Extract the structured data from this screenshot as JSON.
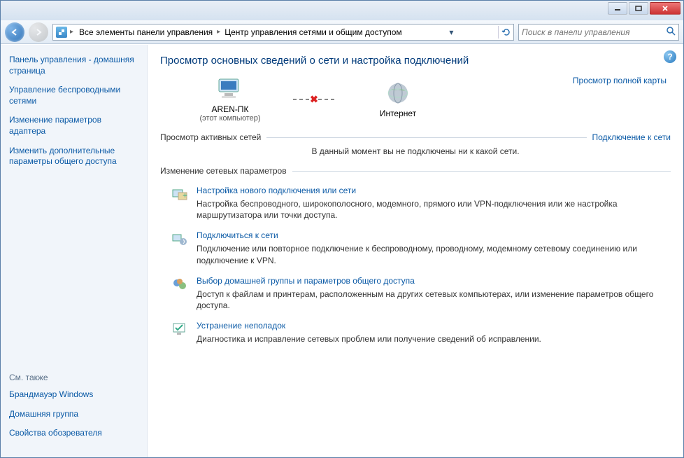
{
  "titlebar": {},
  "navbar": {
    "breadcrumb": {
      "a": "Все элементы панели управления",
      "b": "Центр управления сетями и общим доступом"
    },
    "search_placeholder": "Поиск в панели управления"
  },
  "sidebar": {
    "home": "Панель управления - домашняя страница",
    "links": {
      "wireless": "Управление беспроводными сетями",
      "adapter": "Изменение параметров адаптера",
      "sharing": "Изменить дополнительные параметры общего доступа"
    },
    "see_also_label": "См. также",
    "see_also": {
      "firewall": "Брандмауэр Windows",
      "homegroup": "Домашняя группа",
      "internet_options": "Свойства обозревателя"
    }
  },
  "content": {
    "heading": "Просмотр основных сведений о сети и настройка подключений",
    "map_link": "Просмотр полной карты",
    "nodes": {
      "pc_name": "AREN-ПК",
      "pc_sub": "(этот компьютер)",
      "internet": "Интернет"
    },
    "active_networks_label": "Просмотр активных сетей",
    "connect_link": "Подключение к сети",
    "no_networks_msg": "В данный момент вы не подключены ни к какой сети.",
    "change_settings_label": "Изменение сетевых параметров",
    "tasks": {
      "t1": {
        "title": "Настройка нового подключения или сети",
        "desc": "Настройка беспроводного, широкополосного, модемного, прямого или VPN-подключения или же настройка маршрутизатора или точки доступа."
      },
      "t2": {
        "title": "Подключиться к сети",
        "desc": "Подключение или повторное подключение к беспроводному, проводному, модемному сетевому соединению или подключение к VPN."
      },
      "t3": {
        "title": "Выбор домашней группы и параметров общего доступа",
        "desc": "Доступ к файлам и принтерам, расположенным на других сетевых компьютерах, или изменение параметров общего доступа."
      },
      "t4": {
        "title": "Устранение неполадок",
        "desc": "Диагностика и исправление сетевых проблем или получение сведений об исправлении."
      }
    }
  }
}
